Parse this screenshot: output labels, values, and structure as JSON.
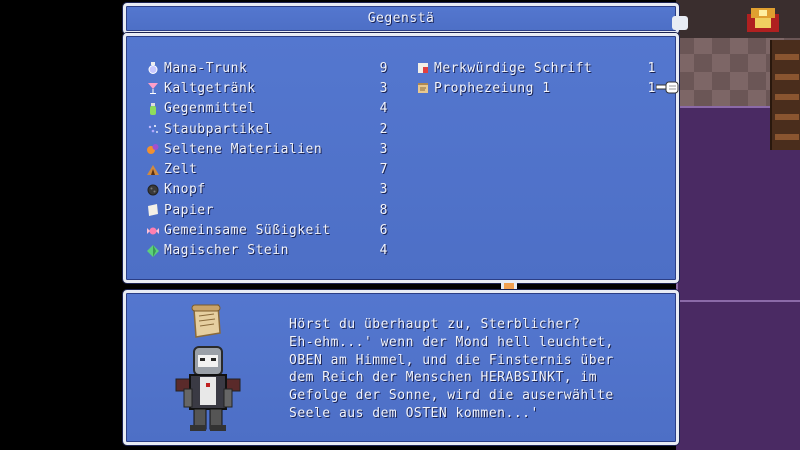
{
  "window_title": "Gegenstä",
  "items_left": [
    {
      "name": "Mana-Trunk",
      "qty": "9",
      "icon": "potion-icon",
      "color": "#d8d8ff"
    },
    {
      "name": "Kaltgetränk",
      "qty": "3",
      "icon": "cocktail-icon",
      "color": "#ff9fc9"
    },
    {
      "name": "Gegenmittel",
      "qty": "4",
      "icon": "antidote-icon",
      "color": "#8fdc5c"
    },
    {
      "name": "Staubpartikel",
      "qty": "2",
      "icon": "sparkle-icon",
      "color": "#b0a8ff"
    },
    {
      "name": "Seltene Materialien",
      "qty": "3",
      "icon": "materials-icon",
      "color": "#f09030"
    },
    {
      "name": "Zelt",
      "qty": "7",
      "icon": "tent-icon",
      "color": "#d08a40"
    },
    {
      "name": "Knopf",
      "qty": "3",
      "icon": "button-icon",
      "color": "#404040"
    },
    {
      "name": "Papier",
      "qty": "8",
      "icon": "paper-icon",
      "color": "#f4f0e6"
    },
    {
      "name": "Gemeinsame Süßigkeit",
      "qty": "6",
      "icon": "candy-icon",
      "color": "#ff7fb0"
    },
    {
      "name": "Magischer Stein",
      "qty": "4",
      "icon": "gem-icon",
      "color": "#5cd07a"
    }
  ],
  "items_right": [
    {
      "name": "Merkwürdige Schrift",
      "qty": "1",
      "icon": "letter-icon",
      "color": "#e04040"
    },
    {
      "name": "Prophezeiung 1",
      "qty": "1",
      "icon": "scroll-icon",
      "color": "#e8c890"
    }
  ],
  "dialog": {
    "lines": [
      "Hörst du überhaupt zu, Sterblicher?",
      "Eh-ehm...' wenn der Mond hell leuchtet,",
      "OBEN am Himmel, und die Finsternis über",
      "dem Reich der Menschen HERABSINKT, im",
      "Gefolge der Sonne, wird die auserwählte",
      "Seele aus dem OSTEN kommen...'"
    ]
  },
  "colors": {
    "window_blue": "#5477cf",
    "window_border": "#e8ecf4",
    "text": "#f2f4fb"
  }
}
